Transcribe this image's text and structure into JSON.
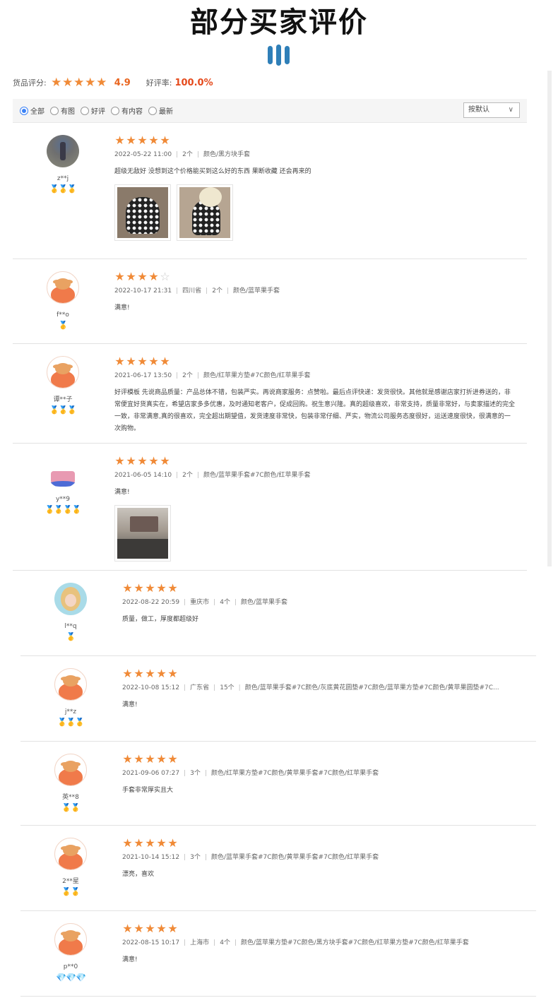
{
  "header": {
    "title": "部分买家评价"
  },
  "summary": {
    "score_label": "货品评分:",
    "score": "4.9",
    "good_rate_label": "好评率:",
    "good_rate": "100.0%",
    "colors": {
      "star": "#f08a37",
      "score": "#e9651f",
      "rate": "#e54a1c"
    }
  },
  "filters": {
    "options": [
      {
        "label": "全部",
        "selected": true
      },
      {
        "label": "有图",
        "selected": false
      },
      {
        "label": "好评",
        "selected": false
      },
      {
        "label": "有内容",
        "selected": false
      },
      {
        "label": "最新",
        "selected": false
      }
    ],
    "sort": "按默认"
  },
  "reviews": [
    {
      "user": "z**j",
      "badges": "🥇🥇🥇",
      "rating": 5,
      "date": "2022-05-22 11:00",
      "location": "",
      "qty": "2个",
      "spec": "颜色/黑方块手套",
      "text": "超级无敌好 没想到这个价格能买到这么好的东西 果断收藏 还会再来的",
      "images": 2
    },
    {
      "user": "f**o",
      "badges": "🥇",
      "rating": 4,
      "date": "2022-10-17 21:31",
      "location": "四川省",
      "qty": "2个",
      "spec": "颜色/蓝苹果手套",
      "text": "满意!",
      "images": 0
    },
    {
      "user": "谭**子",
      "badges": "🥇🥇🥇",
      "rating": 5,
      "date": "2021-06-17 13:50",
      "location": "",
      "qty": "2个",
      "spec": "颜色/红苹果方垫#7C颜色/红苹果手套",
      "text": "好评模板 先说商品质量：产品总体不错，包装严实。再说商家服务：点赞啦。最后点评快递：发货很快。其他就是感谢店家打折进券送的，非常便宜好货真实在，希望店家多多优惠，及时通知老客户，促成回购。祝生意兴隆。真的超级喜欢，非常支持，质量非常好，与卖家描述的完全一致，非常满意,真的很喜欢，完全超出期望值，发货速度非常快，包装非常仔细、严实，物流公司服务态度很好，运送速度很快，很满意的一次购物。",
      "images": 0
    },
    {
      "user": "y**9",
      "badges": "🥇🥇🥇🥇",
      "rating": 5,
      "date": "2021-06-05 14:10",
      "location": "",
      "qty": "2个",
      "spec": "颜色/蓝苹果手套#7C颜色/红苹果手套",
      "text": "满意!",
      "images": 1
    },
    {
      "user": "l**q",
      "badges": "🥇",
      "rating": 5,
      "date": "2022-08-22 20:59",
      "location": "重庆市",
      "qty": "4个",
      "spec": "颜色/蓝苹果手套",
      "text": "质量，做工，厚度都超级好",
      "images": 0
    },
    {
      "user": "j**z",
      "badges": "🥇🥇🥇",
      "rating": 5,
      "date": "2022-10-08 15:12",
      "location": "广东省",
      "qty": "15个",
      "spec": "颜色/蓝苹果手套#7C颜色/灰底黄花圆垫#7C颜色/蓝苹果方垫#7C颜色/黄苹果圆垫#7C...",
      "text": "满意!",
      "images": 0
    },
    {
      "user": "英**8",
      "badges": "🥇🥇",
      "rating": 5,
      "date": "2021-09-06 07:27",
      "location": "",
      "qty": "3个",
      "spec": "颜色/红苹果方垫#7C颜色/黄苹果手套#7C颜色/红苹果手套",
      "text": "手套非常厚实且大",
      "images": 0
    },
    {
      "user": "2**星",
      "badges": "🥇🥇",
      "rating": 5,
      "date": "2021-10-14 15:12",
      "location": "",
      "qty": "3个",
      "spec": "颜色/蓝苹果手套#7C颜色/黄苹果手套#7C颜色/红苹果手套",
      "text": "漂亮，喜欢",
      "images": 0
    },
    {
      "user": "p**0",
      "badges": "💎💎💎",
      "rating": 5,
      "date": "2022-08-15 10:17",
      "location": "上海市",
      "qty": "4个",
      "spec": "颜色/蓝苹果方垫#7C颜色/黑方块手套#7C颜色/红苹果方垫#7C颜色/红苹果手套",
      "text": "满意!",
      "images": 0
    }
  ]
}
